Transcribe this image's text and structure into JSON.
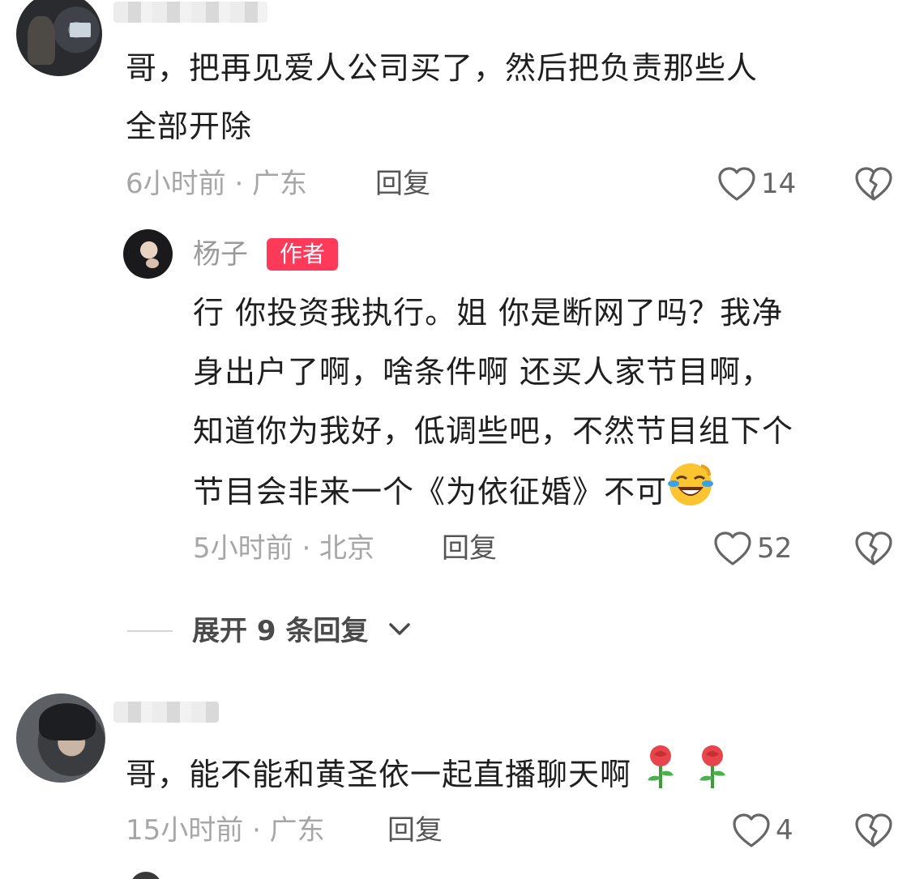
{
  "comments": [
    {
      "text_line1": "哥，把再见爱人公司买了，然后把负责那些人",
      "text_line2": "全部开除",
      "meta": "6小时前 · 广东",
      "reply_label": "回复",
      "likes": "14"
    },
    {
      "author": "杨子",
      "badge": "作者",
      "lines": [
        "行 你投资我执行。姐 你是断网了吗？我净",
        "身出户了啊，啥条件啊 还买人家节目啊，",
        "知道你为我好，低调些吧，不然节目组下个",
        "节目会非来一个《为依征婚》不可"
      ],
      "emoji": "laughing-crying-emoji",
      "meta": "5小时前 · 北京",
      "reply_label": "回复",
      "likes": "52"
    },
    {
      "text": "哥，能不能和黄圣依一起直播聊天啊",
      "emojis": [
        "rose-emoji",
        "rose-emoji"
      ],
      "meta": "15小时前 · 广东",
      "reply_label": "回复",
      "likes": "4"
    }
  ],
  "expand": {
    "label": "展开 9 条回复"
  },
  "colors": {
    "badge": "#fd3a5a",
    "meta": "#a6a6a6",
    "text": "#1f1f1f"
  }
}
